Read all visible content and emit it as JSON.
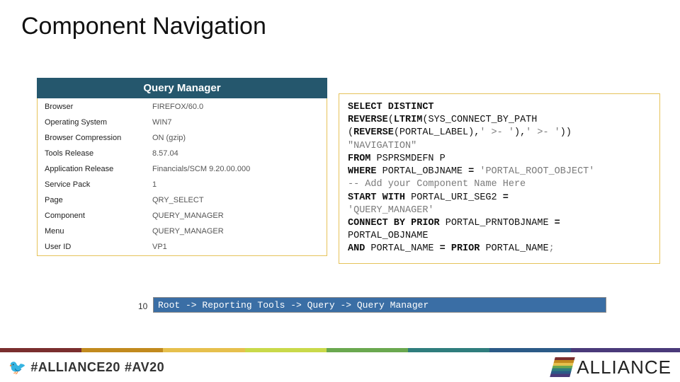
{
  "title": "Component Navigation",
  "banner": "Query Manager",
  "info": [
    {
      "label": "Browser",
      "value": "FIREFOX/60.0"
    },
    {
      "label": "Operating System",
      "value": "WIN7"
    },
    {
      "label": "Browser Compression",
      "value": "ON (gzip)"
    },
    {
      "label": "Tools Release",
      "value": "8.57.04"
    },
    {
      "label": "Application Release",
      "value": "Financials/SCM 9.20.00.000"
    },
    {
      "label": "Service Pack",
      "value": "1"
    },
    {
      "label": "Page",
      "value": "QRY_SELECT"
    },
    {
      "label": "Component",
      "value": "QUERY_MANAGER"
    },
    {
      "label": "Menu",
      "value": "QUERY_MANAGER"
    },
    {
      "label": "User ID",
      "value": "VP1"
    }
  ],
  "sql": {
    "l1a": "SELECT DISTINCT",
    "l2a": "REVERSE",
    "l2b": "(",
    "l2c": "LTRIM",
    "l2d": "(SYS_CONNECT_BY_PATH",
    "l3": "(",
    "l3a": "REVERSE",
    "l3b": "(PORTAL_LABEL),",
    "l3c": "' >- '",
    "l3d": "),",
    "l3e": "' >- '",
    "l3f": "))",
    "l4": "\"NAVIGATION\"",
    "l5a": "FROM",
    "l5b": " PSPRSMDEFN P",
    "l6a": "WHERE",
    "l6b": " PORTAL_OBJNAME ",
    "l6c": "=",
    "l6d": " 'PORTAL_ROOT_OBJECT'",
    "l7": "-- Add your Component Name Here",
    "l8a": "START WITH",
    "l8b": " PORTAL_URI_SEG2 ",
    "l8c": "=",
    "l9": "'QUERY_MANAGER'",
    "l10a": "CONNECT BY PRIOR",
    "l10b": " PORTAL_PRNTOBJNAME ",
    "l10c": "=",
    "l11": "PORTAL_OBJNAME",
    "l12a": "AND",
    "l12b": " PORTAL_NAME ",
    "l12c": "= PRIOR",
    "l12d": " PORTAL_NAME",
    "l12e": ";"
  },
  "result_row_num": "10",
  "result_text": "Root -> Reporting Tools -> Query -> Query Manager",
  "footer": {
    "bird": "🐦",
    "tag1": "#ALLIANCE20",
    "tag2": "#AV20",
    "brand": "ALLIANCE"
  }
}
